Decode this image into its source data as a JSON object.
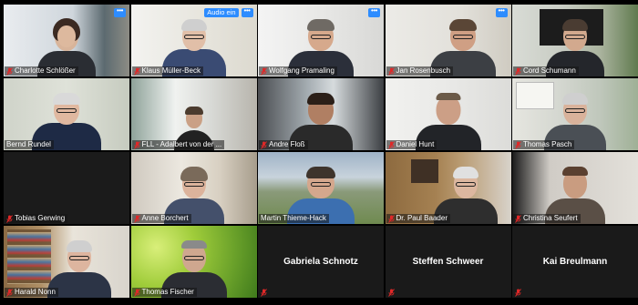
{
  "meeting": {
    "more_label": "•••",
    "audio_label": "Audio ein",
    "colors": {
      "active_border": "#d3de3a",
      "muted_mic": "#e02828",
      "accent": "#2d8cff"
    }
  },
  "participants": [
    {
      "name": "Charlotte Schlößer"
    },
    {
      "name": "Klaus Müller-Beck"
    },
    {
      "name": "Wolfgang Pramaling"
    },
    {
      "name": "Jan Rosenbusch"
    },
    {
      "name": "Cord Schumann"
    },
    {
      "name": "Bernd Rundel"
    },
    {
      "name": "FLL - Adalbert von der ..."
    },
    {
      "name": "Andre Floß"
    },
    {
      "name": "Daniel Hunt"
    },
    {
      "name": "Thomas Pasch"
    },
    {
      "name": "Tobias Gerwing"
    },
    {
      "name": "Anne Borchert"
    },
    {
      "name": "Martin Thieme-Hack"
    },
    {
      "name": "Dr. Paul Baader"
    },
    {
      "name": "Christina Seufert"
    },
    {
      "name": "Harald Nonn"
    },
    {
      "name": "Thomas Fischer"
    },
    {
      "name": "Gabriela Schnotz"
    },
    {
      "name": "Steffen Schweer"
    },
    {
      "name": "Kai Breulmann"
    }
  ]
}
